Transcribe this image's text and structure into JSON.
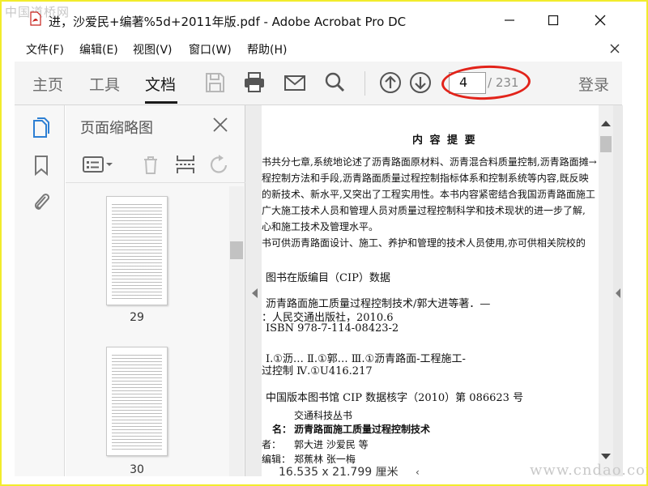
{
  "window": {
    "title": "进，沙爱民+编著%5d+2011年版.pdf - Adobe Acrobat Pro DC",
    "watermark_top": "中国道桥网",
    "watermark_bottom": "www.cndao.com"
  },
  "menu": [
    "文件(F)",
    "编辑(E)",
    "视图(V)",
    "窗口(W)",
    "帮助(H)"
  ],
  "toolbar": {
    "tabs": [
      "主页",
      "工具",
      "文档"
    ],
    "active_tab": "文档",
    "current_page": "4",
    "total_pages": "/ 231",
    "signin": "登录"
  },
  "panel": {
    "title": "页面缩略图",
    "thumbnails": [
      {
        "label": "29"
      },
      {
        "label": "30"
      }
    ]
  },
  "document": {
    "heading": "内 容 提 要",
    "summary_lines": [
      "书共分七章,系统地论述了沥青路面原材料、沥青混合料质量控制,沥青路面摊→",
      "程控制方法和手段,沥青路面质量过程控制指标体系和控制系统等内容,既反映",
      "的新技术、新水平,又突出了工程实用性。本书内容紧密结合我国沥青路面施工",
      "广大施工技术人员和管理人员对质量过程控制科学和技术现状的进一步了解,",
      "心和施工技术及管理水平。",
      "书可供沥青路面设计、施工、养护和管理的技术人员使用,亦可供相关院校的"
    ],
    "cip_title": "图书在版编目（CIP）数据",
    "cip_lines": [
      "沥青路面施工质量过程控制技术/郭大进等著．—",
      "：人民交通出版社，2010.6",
      "ISBN 978-7-114-08423-2"
    ],
    "class_lines": [
      "Ⅰ.①沥…  Ⅱ.①郭…  Ⅲ.①沥青路面-工程施工-",
      "过控制   Ⅳ.①U416.217"
    ],
    "cip_number": "中国版本图书馆 CIP 数据核字（2010）第 086623 号",
    "series": "交通科技丛书",
    "book_name_label": "名：",
    "book_name": "沥青路面施工质量过程控制技术",
    "authors_label": "者：",
    "authors": "郭大进   沙爱民   等",
    "editors_label": "编辑：",
    "editors": "郑蕉林   张一梅",
    "page_size": "16.535 x 21.799 厘米"
  },
  "colors": {
    "annotation_oval": "#e2231a",
    "border": "#f2ec2c"
  }
}
